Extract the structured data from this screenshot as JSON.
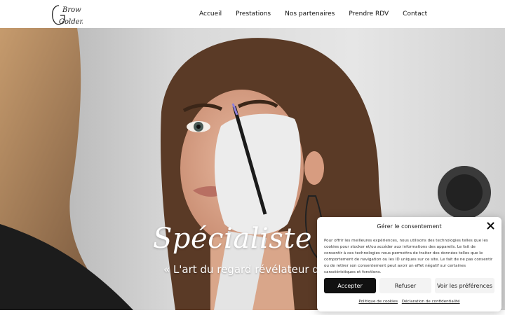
{
  "header": {
    "logo_text": [
      "Brow",
      "Golden"
    ],
    "nav": [
      {
        "label": "Accueil"
      },
      {
        "label": "Prestations"
      },
      {
        "label": "Nos partenaires"
      },
      {
        "label": "Prendre RDV"
      },
      {
        "label": "Contact"
      }
    ]
  },
  "hero": {
    "title": "Spécialiste du reg",
    "subtitle": "« L'art du regard révélateur de bea"
  },
  "consent": {
    "title": "Gérer le consentement",
    "close_icon": "close-icon",
    "text": "Pour offrir les meilleures expériences, nous utilisons des technologies telles que les cookies pour stocker et/ou accéder aux informations des appareils. Le fait de consentir à ces technologies nous permettra de traiter des données telles que le comportement de navigation ou les ID uniques sur ce site. Le fait de ne pas consentir ou de retirer son consentement peut avoir un effet négatif sur certaines caractéristiques et fonctions.",
    "accept_label": "Accepter",
    "refuse_label": "Refuser",
    "prefs_label": "Voir les préférences",
    "cookie_policy_label": "Politique de cookies",
    "privacy_label": "Déclaration de confidentialité"
  },
  "colors": {
    "accept_bg": "#111111",
    "secondary_bg": "#f3f3f3",
    "text": "#111111"
  }
}
